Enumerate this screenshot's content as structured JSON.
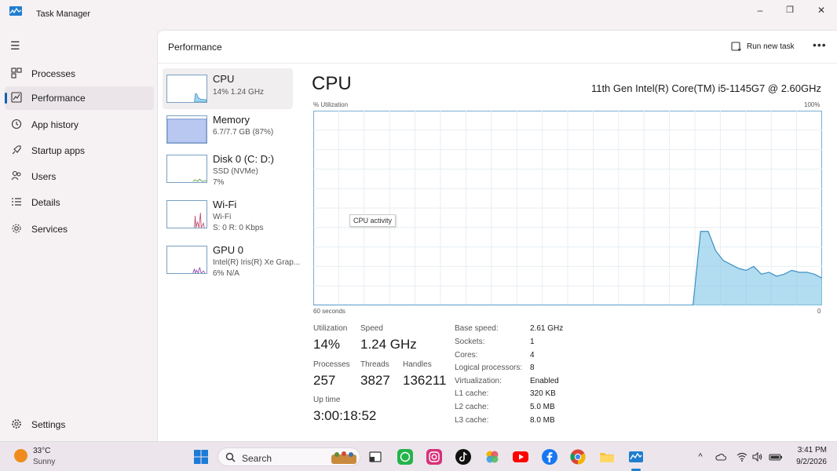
{
  "window": {
    "title": "Task Manager",
    "minimize": "–",
    "maximize": "❐",
    "close": "✕"
  },
  "nav": {
    "items": [
      {
        "label": "Processes"
      },
      {
        "label": "Performance"
      },
      {
        "label": "App history"
      },
      {
        "label": "Startup apps"
      },
      {
        "label": "Users"
      },
      {
        "label": "Details"
      },
      {
        "label": "Services"
      }
    ],
    "settings": "Settings",
    "active": "Performance"
  },
  "header": {
    "title": "Performance",
    "run_new_task": "Run new task",
    "more": "•••"
  },
  "devices": [
    {
      "name": "CPU",
      "line1": "14%  1.24 GHz",
      "line2": ""
    },
    {
      "name": "Memory",
      "line1": "6.7/7.7 GB (87%)",
      "line2": ""
    },
    {
      "name": "Disk 0 (C: D:)",
      "line1": "SSD (NVMe)",
      "line2": "7%"
    },
    {
      "name": "Wi-Fi",
      "line1": "Wi-Fi",
      "line2": "S: 0  R: 0 Kbps"
    },
    {
      "name": "GPU 0",
      "line1": "Intel(R) Iris(R) Xe Grap...",
      "line2": "6%  N/A"
    }
  ],
  "cpu": {
    "title": "CPU",
    "model": "11th Gen Intel(R) Core(TM) i5-1145G7 @ 2.60GHz",
    "graph": {
      "y_label": "% Utilization",
      "y_max_label": "100%",
      "x_left_label": "60 seconds",
      "x_right_label": "0",
      "tooltip": "CPU activity",
      "color": "#7fc4e6",
      "series": [
        0,
        0,
        0,
        0,
        0,
        0,
        0,
        0,
        0,
        0,
        0,
        0,
        0,
        0,
        0,
        0,
        0,
        0,
        0,
        0,
        0,
        0,
        0,
        0,
        0,
        0,
        0,
        0,
        0,
        0,
        0,
        0,
        0,
        0,
        0,
        0,
        0,
        0,
        0,
        0,
        0,
        0,
        0,
        0,
        0,
        0,
        0,
        0,
        0,
        0,
        0,
        38,
        38,
        28,
        23,
        21,
        19,
        18,
        20,
        16,
        17,
        15,
        16,
        18,
        17,
        17,
        16,
        14
      ]
    },
    "stats": {
      "utilization_label": "Utilization",
      "utilization": "14%",
      "speed_label": "Speed",
      "speed": "1.24 GHz",
      "processes_label": "Processes",
      "processes": "257",
      "threads_label": "Threads",
      "threads": "3827",
      "handles_label": "Handles",
      "handles": "136211",
      "uptime_label": "Up time",
      "uptime": "3:00:18:52"
    },
    "specs": [
      {
        "key": "Base speed:",
        "value": "2.61 GHz"
      },
      {
        "key": "Sockets:",
        "value": "1"
      },
      {
        "key": "Cores:",
        "value": "4"
      },
      {
        "key": "Logical processors:",
        "value": "8"
      },
      {
        "key": "Virtualization:",
        "value": "Enabled"
      },
      {
        "key": "L1 cache:",
        "value": "320 KB"
      },
      {
        "key": "L2 cache:",
        "value": "5.0 MB"
      },
      {
        "key": "L3 cache:",
        "value": "8.0 MB"
      }
    ]
  },
  "taskbar": {
    "weather_temp": "33°C",
    "weather_condition": "Sunny",
    "search_placeholder": "Search",
    "time": "3:41 PM",
    "date": "9/2/2026"
  }
}
